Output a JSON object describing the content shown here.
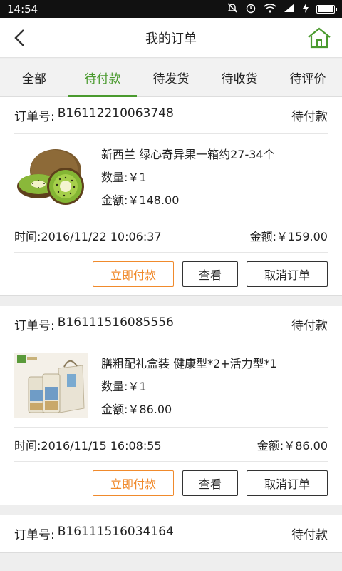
{
  "status_bar": {
    "time": "14:54",
    "icons": [
      "mute-icon",
      "alarm-icon",
      "wifi-icon",
      "signal-icon",
      "charging-icon",
      "battery-icon"
    ],
    "battery_level": 1.0
  },
  "header": {
    "title": "我的订单",
    "back_icon": "back-arrow-icon",
    "home_icon": "home-icon",
    "accent": "#4a9a2e"
  },
  "tabs": [
    {
      "label": "全部",
      "active": false
    },
    {
      "label": "待付款",
      "active": true
    },
    {
      "label": "待发货",
      "active": false
    },
    {
      "label": "待收货",
      "active": false
    },
    {
      "label": "待评价",
      "active": false
    }
  ],
  "labels": {
    "order_no": "订单号:",
    "qty": "数量:",
    "amount": "金额:",
    "time": "时间:",
    "total": "金额:"
  },
  "orders": [
    {
      "order_no": "B16112210063748",
      "status": "待付款",
      "product": {
        "name": "新西兰 绿心奇异果一箱约27-34个",
        "qty": "￥1",
        "amount": "￥148.00",
        "image": "kiwi-image"
      },
      "time": "2016/11/22 10:06:37",
      "total": "￥159.00",
      "actions": {
        "pay": "立即付款",
        "view": "查看",
        "cancel": "取消订单"
      }
    },
    {
      "order_no": "B16111516085556",
      "status": "待付款",
      "product": {
        "name": "膳粗配礼盒装 健康型*2+活力型*1",
        "qty": "￥1",
        "amount": "￥86.00",
        "image": "gift-box-image"
      },
      "time": "2016/11/15 16:08:55",
      "total": "￥86.00",
      "actions": {
        "pay": "立即付款",
        "view": "查看",
        "cancel": "取消订单"
      }
    },
    {
      "order_no": "B16111516034164",
      "status": "待付款"
    }
  ],
  "colors": {
    "pay_button": "#f08a2c",
    "active_tab": "#4a9a2e"
  }
}
